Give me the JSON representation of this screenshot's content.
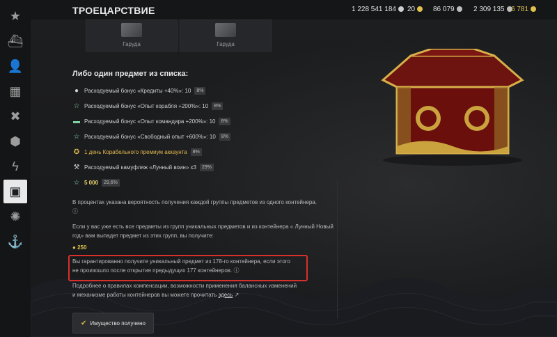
{
  "header": {
    "title": "ТРОЕЦАРСТВИЕ",
    "resources": [
      {
        "value": "1 228 541 184",
        "icon": "credits-icon",
        "color": "#cfcfcf"
      },
      {
        "value": "20",
        "icon": "premium-coin-icon",
        "color": "#e0c14e"
      },
      {
        "value": "86 079",
        "icon": "ship-xp-icon",
        "color": "#bdbdbd"
      },
      {
        "value": "2 309 135",
        "icon": "free-xp-icon",
        "color": "#bdbdbd"
      },
      {
        "value": "6 781",
        "icon": "doubloon-icon",
        "color": "#e0c14e"
      }
    ]
  },
  "cards": [
    {
      "label": "Гаруда"
    },
    {
      "label": "Гаруда"
    }
  ],
  "list": {
    "heading": "Либо один предмет из списка:",
    "items": [
      {
        "icon": "credits-bonus-icon",
        "text": "Расходуемый бонус «Кредиты +40%»: 10",
        "percent": "8%"
      },
      {
        "icon": "ship-xp-bonus-icon",
        "text": "Расходуемый бонус «Опыт корабля +200%»: 10",
        "percent": "8%"
      },
      {
        "icon": "commander-xp-bonus-icon",
        "text": "Расходуемый бонус «Опыт командира +200%»: 10",
        "percent": "8%"
      },
      {
        "icon": "free-xp-bonus-icon",
        "text": "Расходуемый бонус «Свободный опыт +600%»: 10",
        "percent": "8%"
      },
      {
        "icon": "premium-account-icon",
        "text": "1 день Корабельного премиум аккаунта",
        "percent": "8%"
      },
      {
        "icon": "camouflage-icon",
        "text": "Расходуемый камуфляж «Лунный воин» x3",
        "percent": "29%"
      },
      {
        "icon": "free-xp-star-icon",
        "text": "5 000",
        "percent": "29,6%"
      }
    ]
  },
  "info": {
    "p1": "В процентах указана вероятность получения каждой группы предметов из одного контейнера.",
    "p2": "Если у вас уже есть все предметы из групп уникальных предметов и из контейнера « Лунный Новый год» вам выпадет предмет из этих групп, вы получите:",
    "reward_value": "250",
    "p3_part1": "Вы гарантированно получите уникальный предмет из 178-го контейнера, если этого",
    "p3_part2": "не произошло после открытия предыдущих 177 контейнеров.",
    "p4_part1": "Подробнее о правилах компенсации, возможности применения балансных изменений",
    "p4_part2": "и механизме работы контейнеров вы можете прочитать",
    "p4_link": "здесь"
  },
  "button": {
    "label": "Имущество получено"
  },
  "colors": {
    "accent_gold": "#d7b24a",
    "highlight_red": "#d9302b"
  }
}
